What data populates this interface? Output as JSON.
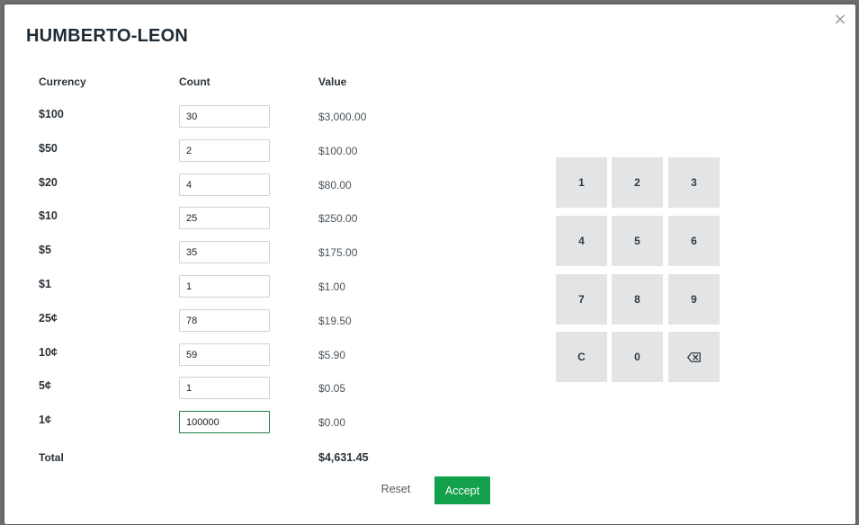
{
  "dialog": {
    "title": "HUMBERTO-LEON",
    "close_icon": "×"
  },
  "table": {
    "headers": {
      "currency": "Currency",
      "count": "Count",
      "value": "Value"
    },
    "rows": [
      {
        "currency": "$100",
        "count": "30",
        "value": "$3,000.00"
      },
      {
        "currency": "$50",
        "count": "2",
        "value": "$100.00"
      },
      {
        "currency": "$20",
        "count": "4",
        "value": "$80.00"
      },
      {
        "currency": "$10",
        "count": "25",
        "value": "$250.00"
      },
      {
        "currency": "$5",
        "count": "35",
        "value": "$175.00"
      },
      {
        "currency": "$1",
        "count": "1",
        "value": "$1.00"
      },
      {
        "currency": "25¢",
        "count": "78",
        "value": "$19.50"
      },
      {
        "currency": "10¢",
        "count": "59",
        "value": "$5.90"
      },
      {
        "currency": "5¢",
        "count": "1",
        "value": "$0.05"
      },
      {
        "currency": "1¢",
        "count": "100000",
        "value": "$0.00"
      }
    ],
    "total_label": "Total",
    "total_value": "$4,631.45"
  },
  "actions": {
    "reset_label": "Reset",
    "accept_label": "Accept"
  },
  "keypad": {
    "keys": [
      "1",
      "2",
      "3",
      "4",
      "5",
      "6",
      "7",
      "8",
      "9",
      "C",
      "0"
    ],
    "backspace_icon": "backspace-icon"
  },
  "colors": {
    "accent": "#12a04a",
    "focus_border": "#1e7e4a",
    "key_bg": "#e3e4e6"
  }
}
